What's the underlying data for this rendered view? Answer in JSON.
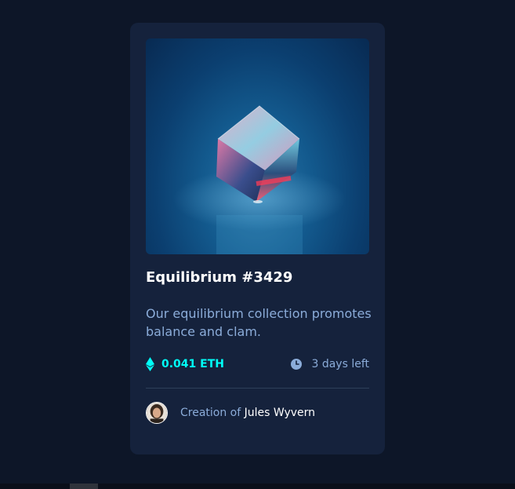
{
  "card": {
    "image_alt": "Equilibrium cube",
    "title": "Equilibrium #3429",
    "description": "Our equilibrium collection promotes balance and clam.",
    "price": "0.041 ETH",
    "time_left": "3 days left",
    "creator_prefix": "Creation of ",
    "creator_name": "Jules Wyvern"
  },
  "icons": {
    "eth": "ethereum-icon",
    "clock": "clock-icon",
    "avatar": "creator-avatar"
  },
  "colors": {
    "page_bg": "#0d1628",
    "card_bg": "#15223c",
    "accent_cyan": "#00fff8",
    "soft_blue": "#8bacd9",
    "white": "#ffffff",
    "divider": "#2e405a"
  }
}
